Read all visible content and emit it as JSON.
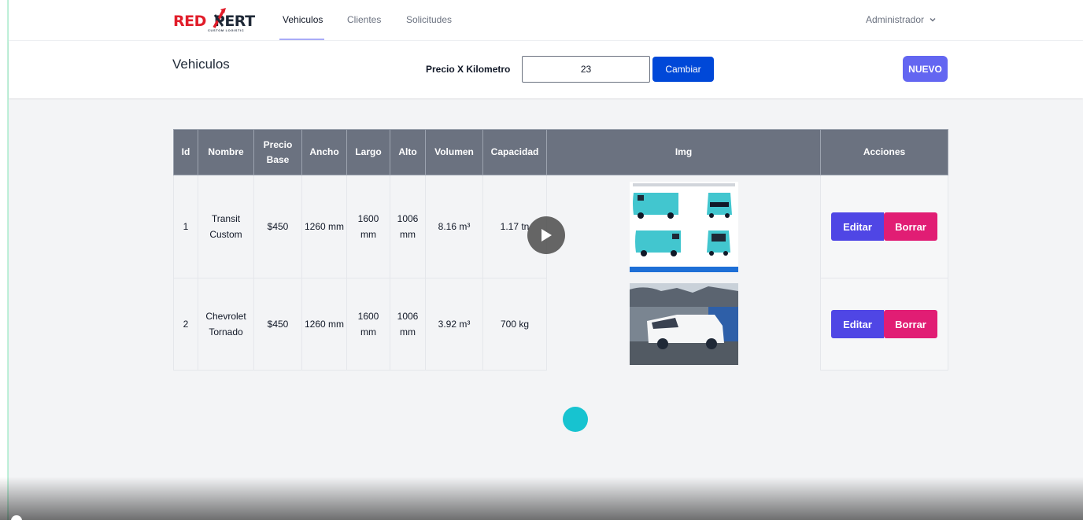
{
  "brand": {
    "logo_text_red": "RED",
    "logo_text_dark": "PERT",
    "logo_tagline": "CUSTOM LOGISTIC",
    "accent": "#e11d2a"
  },
  "nav": {
    "links": [
      {
        "label": "Vehiculos"
      },
      {
        "label": "Clientes"
      },
      {
        "label": "Solicitudes"
      }
    ],
    "user": "Administrador"
  },
  "header": {
    "title": "Vehiculos",
    "price_label": "Precio X Kilometro",
    "price_value": "23",
    "change_label": "Cambiar",
    "new_label": "NUEVO"
  },
  "table": {
    "columns": [
      "Id",
      "Nombre",
      "Precio Base",
      "Ancho",
      "Largo",
      "Alto",
      "Volumen",
      "Capacidad",
      "Img",
      "Acciones"
    ],
    "rows": [
      {
        "id": "1",
        "name": "Transit Custom",
        "price": "$450",
        "width": "1260 mm",
        "length": "1600 mm",
        "height": "1006 mm",
        "volume": "8.16 m³",
        "capacity": "1.17 tn",
        "img": "teal-van-diagram",
        "edit": "Editar",
        "delete": "Borrar"
      },
      {
        "id": "2",
        "name": "Chevrolet Tornado",
        "price": "$450",
        "width": "1260 mm",
        "length": "1600 mm",
        "height": "1006 mm",
        "volume": "3.92 m³",
        "capacity": "700 kg",
        "img": "white-pickup-photo",
        "edit": "Editar",
        "delete": "Borrar"
      }
    ]
  },
  "colors": {
    "primary": "#0048d8",
    "indigo": "#6366f1",
    "edit": "#4f46e5",
    "delete": "#e11d74",
    "header_gray": "#6b7280",
    "cursor": "#17c3d0"
  },
  "icons": [
    "chevron-down-icon",
    "play-icon"
  ]
}
